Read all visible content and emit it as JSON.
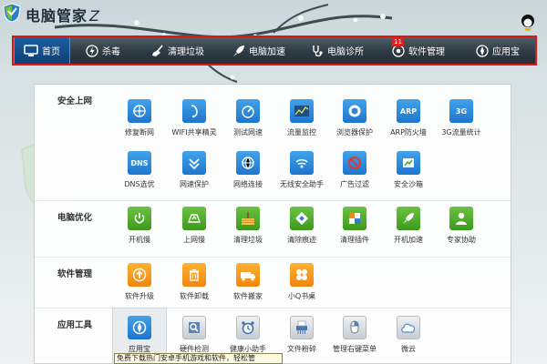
{
  "app": {
    "title": "电脑管家",
    "title_mark": "Z"
  },
  "nav": {
    "items": [
      {
        "label": "首页",
        "icon": "monitor-icon"
      },
      {
        "label": "杀毒",
        "icon": "lightning-icon"
      },
      {
        "label": "清理垃圾",
        "icon": "broom-icon"
      },
      {
        "label": "电脑加速",
        "icon": "rocket-icon"
      },
      {
        "label": "电脑诊所",
        "icon": "stethoscope-icon"
      },
      {
        "label": "软件管理",
        "icon": "software-icon",
        "badge": "11"
      },
      {
        "label": "应用宝",
        "icon": "app-store-icon"
      }
    ]
  },
  "sections": [
    {
      "title": "安全上网",
      "tiles": [
        {
          "label": "修复断网",
          "icon": "network-repair-icon",
          "color": "blue"
        },
        {
          "label": "WIFI共享精灵",
          "icon": "wifi-share-icon",
          "color": "blue"
        },
        {
          "label": "测试网速",
          "icon": "speed-test-icon",
          "color": "blue"
        },
        {
          "label": "流量监控",
          "icon": "traffic-monitor-icon",
          "color": "blue"
        },
        {
          "label": "浏览器保护",
          "icon": "browser-protect-icon",
          "color": "blue"
        },
        {
          "label": "ARP防火墙",
          "icon": "arp-firewall-icon",
          "color": "blue",
          "glyph": "ARP"
        },
        {
          "label": "3G流量统计",
          "icon": "3g-traffic-icon",
          "color": "blue",
          "glyph": "3G"
        },
        {
          "label": "DNS选优",
          "icon": "dns-icon",
          "color": "blue",
          "glyph": "DNS"
        },
        {
          "label": "网速保护",
          "icon": "speed-protect-icon",
          "color": "blue"
        },
        {
          "label": "网络连接",
          "icon": "network-connect-icon",
          "color": "blue"
        },
        {
          "label": "无线安全助手",
          "icon": "wireless-security-icon",
          "color": "blue"
        },
        {
          "label": "广告过滤",
          "icon": "ad-filter-icon",
          "color": "blue"
        },
        {
          "label": "安全沙箱",
          "icon": "sandbox-icon",
          "color": "blue"
        }
      ]
    },
    {
      "title": "电脑优化",
      "tiles": [
        {
          "label": "开机慢",
          "icon": "power-icon",
          "color": "green"
        },
        {
          "label": "上网慢",
          "icon": "slow-net-icon",
          "color": "green"
        },
        {
          "label": "清理垃圾",
          "icon": "cleanup-icon",
          "color": "green"
        },
        {
          "label": "清除痕迹",
          "icon": "erase-traces-icon",
          "color": "green"
        },
        {
          "label": "清理插件",
          "icon": "plugin-clean-icon",
          "color": "green"
        },
        {
          "label": "开机加速",
          "icon": "boot-speedup-icon",
          "color": "green"
        },
        {
          "label": "专家协助",
          "icon": "expert-icon",
          "color": "green"
        }
      ]
    },
    {
      "title": "软件管理",
      "tiles": [
        {
          "label": "软件升级",
          "icon": "upgrade-icon",
          "color": "orange"
        },
        {
          "label": "软件卸载",
          "icon": "uninstall-icon",
          "color": "orange"
        },
        {
          "label": "软件搬家",
          "icon": "move-software-icon",
          "color": "orange"
        },
        {
          "label": "小Q书桌",
          "icon": "qq-desk-icon",
          "color": "orange"
        }
      ]
    },
    {
      "title": "应用工具",
      "tiles": [
        {
          "label": "应用宝",
          "icon": "app-store-icon",
          "color": "blue"
        },
        {
          "label": "硬件检测",
          "icon": "hardware-check-icon",
          "color": "gray"
        },
        {
          "label": "健康小助手",
          "icon": "alarm-clock-icon",
          "color": "gray"
        },
        {
          "label": "文件粉碎",
          "icon": "file-shredder-icon",
          "color": "gray"
        },
        {
          "label": "管理右键菜单",
          "icon": "context-menu-icon",
          "color": "gray"
        },
        {
          "label": "微云",
          "icon": "weiyun-cloud-icon",
          "color": "gray"
        }
      ]
    }
  ],
  "tooltip": "免费下载热门安卓手机游戏和软件，轻松管"
}
